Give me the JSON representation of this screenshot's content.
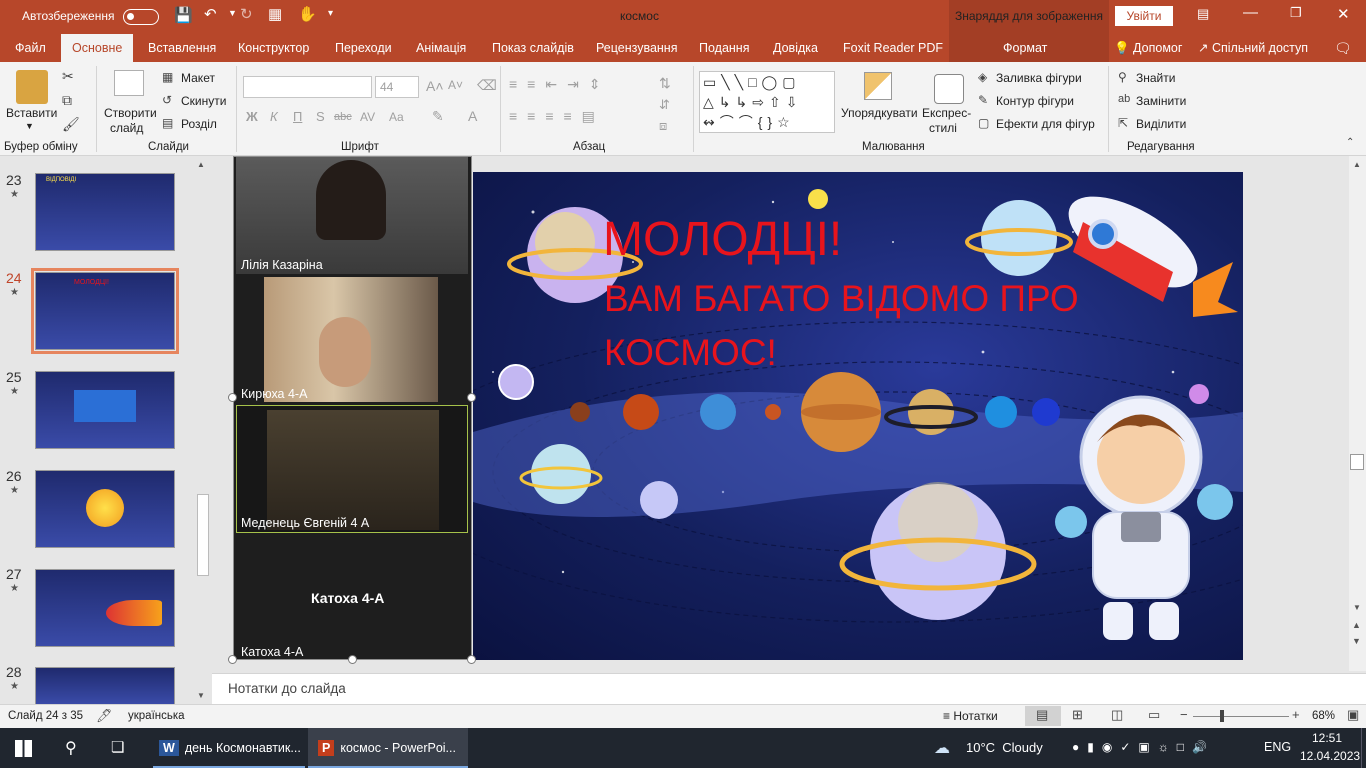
{
  "titlebar": {
    "autosave_label": "Автозбереження",
    "title": "космос",
    "context_header": "Знаряддя для зображення",
    "signin": "Увійти"
  },
  "tabs": [
    "Файл",
    "Основне",
    "Вставлення",
    "Конструктор",
    "Переходи",
    "Анімація",
    "Показ слайдів",
    "Рецензування",
    "Подання",
    "Довідка",
    "Foxit Reader PDF"
  ],
  "context_tab": "Формат",
  "help_label": "Допомог",
  "share_label": "Спільний доступ",
  "ribbon": {
    "clipboard": {
      "paste": "Вставити",
      "group": "Буфер обміну"
    },
    "slides": {
      "new_slide_line1": "Створити",
      "new_slide_line2": "слайд",
      "layout": "Макет",
      "reset": "Скинути",
      "section": "Розділ",
      "group": "Слайди"
    },
    "font": {
      "size": "44",
      "bold": "Ж",
      "italic": "К",
      "underline": "П",
      "strike": "S",
      "shadow": "abc",
      "spacing": "AV",
      "case": "Aa",
      "group": "Шрифт"
    },
    "paragraph": {
      "group": "Абзац"
    },
    "drawing": {
      "arrange": "Упорядкувати",
      "quick_styles_line1": "Експрес-",
      "quick_styles_line2": "стилі",
      "fill": "Заливка фігури",
      "outline": "Контур фігури",
      "effects": "Ефекти для фігур",
      "group": "Малювання"
    },
    "editing": {
      "find": "Знайти",
      "replace": "Замінити",
      "select": "Виділити",
      "group": "Редагування"
    }
  },
  "thumbnails": [
    {
      "num": "23",
      "caption": "ВІДПОВІДІ"
    },
    {
      "num": "24",
      "caption": "МОЛОДЦІ!"
    },
    {
      "num": "25",
      "caption": ""
    },
    {
      "num": "26",
      "caption": ""
    },
    {
      "num": "27",
      "caption": ""
    },
    {
      "num": "28",
      "caption": ""
    }
  ],
  "video": [
    {
      "name": "Лілія Казаріна"
    },
    {
      "name": "Кирюха 4-А"
    },
    {
      "name": "Меденець Євгеній 4 А"
    },
    {
      "name": "Катоха 4-А",
      "center": "Катоха 4-А"
    }
  ],
  "slide": {
    "line1": "МОЛОДЦІ!",
    "line2": "ВАМ БАГАТО ВІДОМО ПРО",
    "line3": "КОСМОС!"
  },
  "notes_placeholder": "Нотатки до слайда",
  "status": {
    "slide": "Слайд 24 з 35",
    "language": "українська",
    "notes": "Нотатки",
    "zoom": "68%"
  },
  "taskbar": {
    "apps": [
      "день Космонавтик...",
      "космос - PowerPoi..."
    ],
    "weather": "10°C  Cloudy",
    "lang": "ENG",
    "time": "12:51",
    "date": "12.04.2023"
  },
  "colors": {
    "accent": "#b7472a",
    "slide_text": "#e8141c",
    "selection": "#e6855e"
  }
}
